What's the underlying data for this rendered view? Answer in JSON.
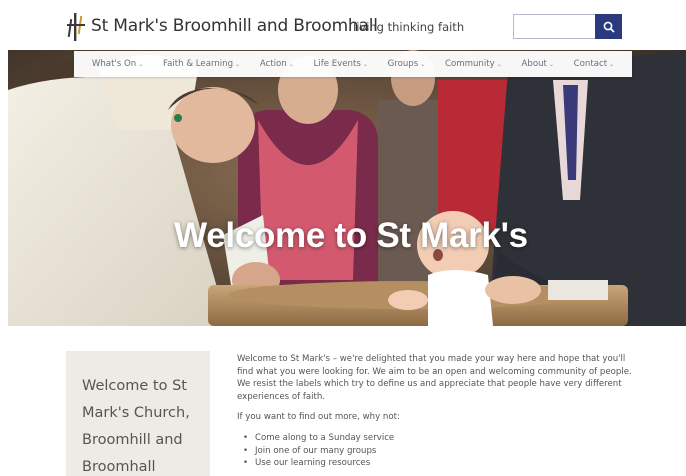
{
  "header": {
    "logo_icon": "church-cross-icon",
    "site_title": "St Mark's Broomhill and Broomhall",
    "tagline": "living thinking faith",
    "search_placeholder": "",
    "search_icon": "search-icon",
    "accent_color": "#2b3a7e"
  },
  "nav": {
    "items": [
      {
        "label": "What's On"
      },
      {
        "label": "Faith & Learning"
      },
      {
        "label": "Action"
      },
      {
        "label": "Life Events"
      },
      {
        "label": "Groups"
      },
      {
        "label": "Community"
      },
      {
        "label": "About"
      },
      {
        "label": "Contact"
      }
    ],
    "caret": "⌄"
  },
  "hero": {
    "title": "Welcome to St Mark's"
  },
  "sidebar": {
    "heading": "Welcome to St Mark's Church, Broomhill and Broomhall"
  },
  "main": {
    "intro": "Welcome to St Mark's – we're delighted that you made your way here and hope that you'll find what you were looking for. We aim to be an open and welcoming community of people. We resist the labels which try to define us and appreciate that people have very different experiences of faith.",
    "find_out_more": "If you want to find out more, why not:",
    "list": [
      "Come along to a Sunday service",
      "Join one of our many groups",
      "Use our learning resources"
    ]
  }
}
